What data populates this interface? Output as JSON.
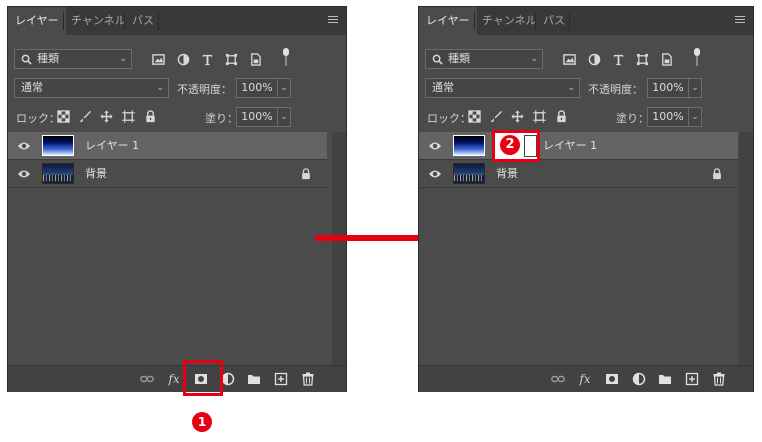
{
  "panel_left": {
    "tabs": [
      {
        "label": "レイヤー"
      },
      {
        "label": "チャンネル"
      },
      {
        "label": "パス"
      }
    ],
    "filter_label": "種類",
    "blend_mode": "通常",
    "opacity_label": "不透明度：",
    "opacity_value": "100%",
    "lock_label": "ロック：",
    "fill_label": "塗り：",
    "fill_value": "100%",
    "layers": [
      {
        "name": "レイヤー 1"
      },
      {
        "name": "背景"
      }
    ]
  },
  "panel_right": {
    "tabs": [
      {
        "label": "レイヤー"
      },
      {
        "label": "チャンネル"
      },
      {
        "label": "パス"
      }
    ],
    "filter_label": "種類",
    "blend_mode": "通常",
    "opacity_label": "不透明度：",
    "opacity_value": "100%",
    "lock_label": "ロック：",
    "fill_label": "塗り：",
    "fill_value": "100%",
    "layers": [
      {
        "name": "レイヤー 1"
      },
      {
        "name": "背景"
      }
    ]
  },
  "annotations": {
    "step1": "1",
    "step2": "2"
  },
  "colors": {
    "panel": "#4b4b4b",
    "highlight": "#e60012",
    "selected_row": "#636363"
  }
}
